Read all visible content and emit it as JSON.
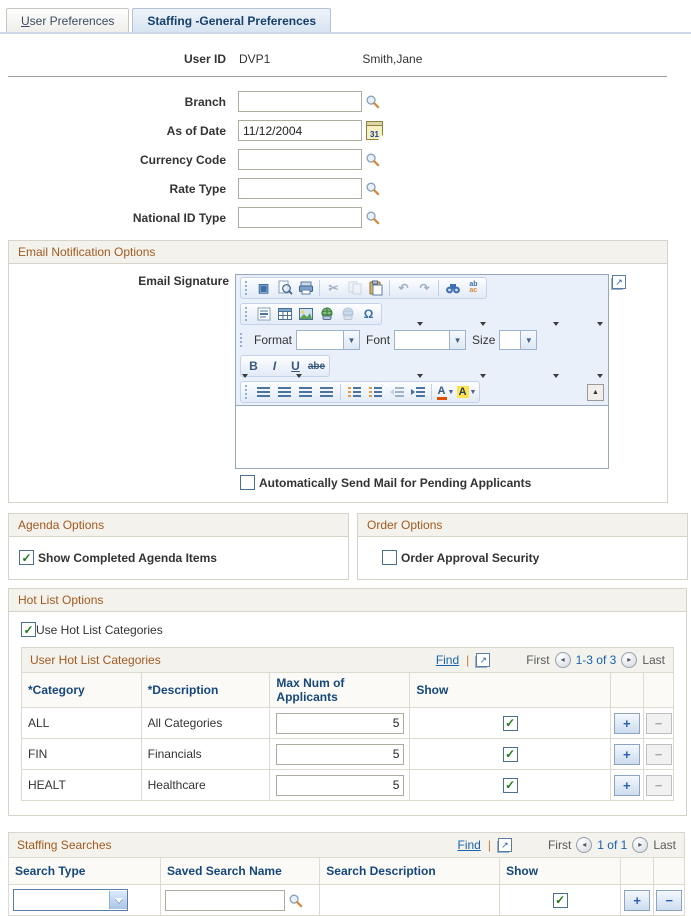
{
  "colors": {
    "accent_orange": "#a25a1e",
    "link_blue": "#1763ac",
    "header_navy": "#15477d",
    "check_green": "#1e7d1e"
  },
  "tabs": {
    "inactive": "User Preferences",
    "active": "Staffing -General Preferences"
  },
  "user": {
    "label": "User ID",
    "value": "DVP1",
    "name": "Smith,Jane"
  },
  "fields": {
    "branch": {
      "label": "Branch",
      "value": ""
    },
    "asofdate": {
      "label": "As of Date",
      "value": "11/12/2004",
      "calendar_text": "31"
    },
    "currency": {
      "label": "Currency Code",
      "value": ""
    },
    "ratetype": {
      "label": "Rate Type",
      "value": ""
    },
    "nationalid": {
      "label": "National ID Type",
      "value": ""
    }
  },
  "email": {
    "title": "Email Notification Options",
    "signature_label": "Email Signature",
    "toolbar": {
      "format": "Format",
      "font": "Font",
      "size": "Size",
      "bold": "B",
      "italic": "I",
      "underline": "U",
      "strike": "abe",
      "omega": "Ω"
    },
    "auto_send": {
      "label": "Automatically Send Mail for Pending Applicants",
      "checked": false
    }
  },
  "agenda": {
    "title": "Agenda Options",
    "checkbox_label": "Show Completed Agenda Items",
    "checked": true
  },
  "order": {
    "title": "Order Options",
    "checkbox_label": "Order Approval Security",
    "checked": false
  },
  "hotlist": {
    "title": "Hot List Options",
    "use_label": "Use Hot List Categories",
    "use_checked": true,
    "grid": {
      "title": "User Hot List Categories",
      "find": "Find",
      "first": "First",
      "range": "1-3 of 3",
      "last": "Last",
      "headers": {
        "category": "*Category",
        "description": "*Description",
        "max": "Max Num of Applicants",
        "show": "Show"
      },
      "rows": [
        {
          "category": "ALL",
          "description": "All Categories",
          "max": "5",
          "show": true
        },
        {
          "category": "FIN",
          "description": "Financials",
          "max": "5",
          "show": true
        },
        {
          "category": "HEALT",
          "description": "Healthcare",
          "max": "5",
          "show": true
        }
      ]
    }
  },
  "staffing": {
    "title": "Staffing Searches",
    "find": "Find",
    "first": "First",
    "range": "1 of 1",
    "last": "Last",
    "headers": {
      "type": "Search Type",
      "name": "Saved Search Name",
      "desc": "Search Description",
      "show": "Show"
    },
    "row": {
      "search_type": "",
      "saved_search_name": "",
      "description": "",
      "show": true
    }
  }
}
